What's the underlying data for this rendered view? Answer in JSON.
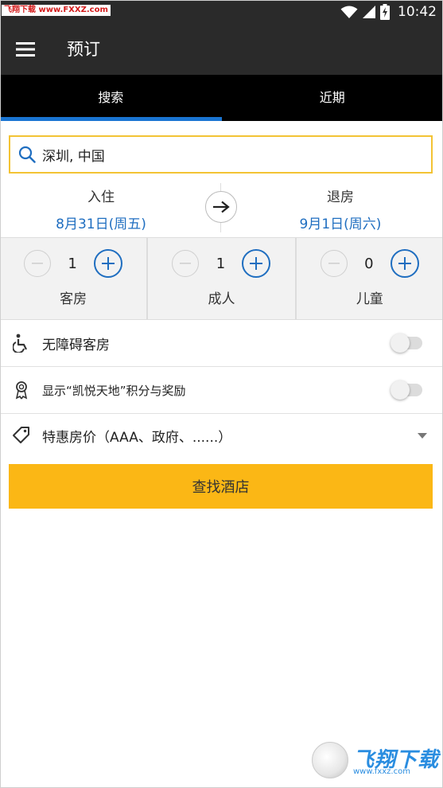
{
  "status_bar": {
    "watermark": "飞翔下载 www.FXXZ.com",
    "time": "10:42",
    "icons": [
      "wifi-icon",
      "cell-signal-icon",
      "battery-charging-icon"
    ]
  },
  "app_bar": {
    "title": "预订",
    "menu_icon": "hamburger-menu-icon"
  },
  "tabs": [
    {
      "label": "搜索",
      "active": true
    },
    {
      "label": "近期",
      "active": false
    }
  ],
  "search": {
    "value": "深圳, 中国",
    "icon": "search-icon",
    "border_color": "#f3c334"
  },
  "dates": {
    "checkin_label": "入住",
    "checkin_value": "8月31日(周五)",
    "checkout_label": "退房",
    "checkout_value": "9月1日(周六)",
    "arrow_icon": "arrow-right-icon"
  },
  "counters": [
    {
      "label": "客房",
      "value": "1"
    },
    {
      "label": "成人",
      "value": "1"
    },
    {
      "label": "儿童",
      "value": "0"
    }
  ],
  "options": {
    "accessible": {
      "label": "无障碍客房",
      "icon": "wheelchair-icon",
      "on": false
    },
    "rewards": {
      "label": "显示“凯悦天地”积分与奖励",
      "icon": "award-ribbon-icon",
      "on": false
    },
    "special_rates": {
      "label": "特惠房价（AAA、政府、......）",
      "icon": "price-tag-icon"
    }
  },
  "find_button": {
    "label": "查找酒店",
    "color": "#fbb715"
  },
  "bottom_watermark": {
    "brand": "飞翔下载",
    "url": "www.fxxz.com"
  },
  "colors": {
    "header_bg": "#2a2a2a",
    "tabs_bg": "#000000",
    "accent_blue": "#1f6ec0",
    "tab_indicator": "#1a75d2"
  }
}
